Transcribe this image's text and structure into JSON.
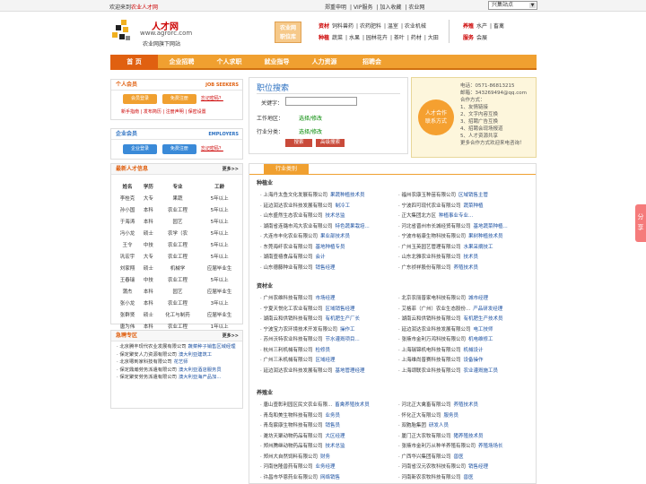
{
  "topbar": {
    "welcome_pre": "欢迎来到",
    "welcome_site": "农业人才网",
    "links": [
      "郑重申明",
      "VIP服务",
      "加入收藏",
      "农业网"
    ],
    "site_select": "兴集站点"
  },
  "logo": {
    "name": "人才网",
    "url": "www.agrorc.com",
    "slogan": "农业网旗下网站"
  },
  "category_box": "农业网\n职位库",
  "categories": {
    "row1": {
      "key": "资材",
      "items": [
        "饲料兽药",
        "农药肥料",
        "温室",
        "农业机械"
      ]
    },
    "row2": {
      "key": "种植",
      "items": [
        "蔬菜",
        "水果",
        "园林花卉",
        "茶叶",
        "药材",
        "大田"
      ]
    },
    "row3": {
      "key": "养殖",
      "items": [
        "水产",
        "畜禽"
      ]
    },
    "row4": {
      "key": "服务",
      "items": [
        "会展"
      ]
    }
  },
  "nav": [
    "首 页",
    "企业招聘",
    "个人求职",
    "就业指导",
    "人力资源",
    "招聘会"
  ],
  "personal": {
    "title": "个人会员",
    "en": "JOB SEEKERS",
    "login": "会员登录",
    "register": "免费注册",
    "forgot": "忘记密码？",
    "links": [
      "新手指南",
      "发布简历",
      "注册声明",
      "保密设置"
    ]
  },
  "company": {
    "title": "企业会员",
    "en": "EMPLOYERS",
    "login": "企业登录",
    "register": "免费注册",
    "forgot": "忘记密码？"
  },
  "newtalent": {
    "title": "最新人才信息",
    "more": "更多>>",
    "headers": [
      "姓名",
      "学历",
      "专业",
      "工龄"
    ],
    "rows": [
      [
        "李桂克",
        "大专",
        "果蔬",
        "5年以上"
      ],
      [
        "孙小国",
        "本科",
        "农业工程",
        "5年以上"
      ],
      [
        "于海涛",
        "本科",
        "园艺",
        "5年以上"
      ],
      [
        "冯小龙",
        "硕士",
        "农学（农",
        "5年以上"
      ],
      [
        "王令",
        "中技",
        "农业工程",
        "5年以上"
      ],
      [
        "巩宏宇",
        "大专",
        "农业工程",
        "5年以上"
      ],
      [
        "刘家翔",
        "硕士",
        "机械学",
        "应届毕业生"
      ],
      [
        "王春瑞",
        "中技",
        "农业工程",
        "5年以上"
      ],
      [
        "蒲杰",
        "本科",
        "园艺",
        "应届毕业生"
      ],
      [
        "张小龙",
        "本科",
        "农业工程",
        "3年以上"
      ],
      [
        "张群贤",
        "硕士",
        "化工与制药",
        "应届毕业生"
      ],
      [
        "唐为伟",
        "本科",
        "农业工程",
        "1年以上"
      ]
    ]
  },
  "urgent": {
    "title": "急聘专区",
    "more": "更多>>",
    "items": [
      [
        "北京腾丰现代农业发展有限公司",
        "蔬菜种子销售区域经理"
      ],
      [
        "保定聚安人力资源有限公司",
        "澳大利亚建筑工"
      ],
      [
        "北京嗯到家科技有限公司",
        "花艺师"
      ],
      [
        "保定鼎瀚劳务派遣有限公司",
        "澳大利亚酒店服务员"
      ],
      [
        "保定聚安劳务派遣有限公司",
        "澳大利亚海产品加..."
      ]
    ]
  },
  "search": {
    "title": "职位搜索",
    "keyword_label": "关键字：",
    "area_label": "工作地区：",
    "area_value": "选择/修改",
    "cat_label": "行业分类：",
    "cat_value": "选择/修改",
    "search_btn": "搜索",
    "adv_btn": "高级搜索"
  },
  "contact": {
    "badge": "人才合作\n联系方式",
    "phone": "电话：0571-86813215",
    "qq": "邮箱：343269494@qq.com",
    "coop": "合作方式：",
    "items": [
      "1、友情链接",
      "2、文字内容互换",
      "3、招聘广告互换",
      "4、招聘会现场报道",
      "5、人才资源共享"
    ],
    "more": "更多合作方式欢迎来电咨询！"
  },
  "industry": {
    "tab": "行业类别",
    "sections": [
      {
        "title": "种植业",
        "rows": [
          [
            "上海丹太鱼文化发展有限公司",
            "果蔬种植技术员",
            "福州农康玉种苗有限公司",
            "区域销售主管"
          ],
          [
            "延边润达农业科技发展有限公司",
            "制冷工",
            "宁波四可现代农业有限公司",
            "蔬菜种植"
          ],
          [
            "山东盛然生态农业有限公司",
            "技术总监",
            "正大集团北方区",
            "种植事业专业..."
          ],
          [
            "湖南省连璐市鸿大农业有限公司",
            "特色蔬果栽培...",
            "河北省晋州市长城经贸有限公司",
            "基地蔬菜种植..."
          ],
          [
            "大连市丰化农业有限公司",
            "果业部技术员",
            "宁波市裕康生物科技有限公司",
            "果树种植技术员"
          ],
          [
            "东莞海纤农业有限公司",
            "基地种植专员",
            "广州玉英园艺管理有限公司",
            "水果采摘技工"
          ],
          [
            "湖南壹禧食品有限公司",
            "会计",
            "山东北雅农业科技有限公司",
            "技术员"
          ],
          [
            "山东德藤种业有限公司",
            "销售经理",
            "广东祯祥股份有限公司",
            "养殖技术员"
          ]
        ]
      },
      {
        "title": "资材业",
        "rows": [
          [
            "广州农维科技有限公司",
            "市场经理",
            "北京农丽普家电科技有限公司",
            "城市经理"
          ],
          [
            "宁夏天悦化工农业有限公司",
            "区域销售经理",
            "艾格菲（广州）农业生态股份...",
            "产品研发经理"
          ],
          [
            "湖南云和供销科技有限公司",
            "有机肥生产厂长",
            "湖南云和供销科技有限公司",
            "有机肥生产技术员"
          ],
          [
            "宁波宝力农环境技术开发有限公司",
            "操作工",
            "延边润达农业科技发展有限公司",
            "电工技师"
          ],
          [
            "苏州沃特农业科技有限公司",
            "节水灌溉项目...",
            "张掖市金利万鸿科技有限公司",
            "机电维修工"
          ],
          [
            "杭州三利机械有限公司",
            "检修员",
            "上海瑞锦机电科技有限公司",
            "机械设计"
          ],
          [
            "广州三禾机械有限公司",
            "区域经理",
            "上海维尚普赛科技有限公司",
            "设备操作"
          ],
          [
            "延边润达农业科技发展有限公司",
            "基地管理经理",
            "上海颂联农业科技有限公司",
            "农业灌溉施工员"
          ]
        ]
      },
      {
        "title": "养殖业",
        "rows": [
          [
            "唐山壹彰利园区民文农业有限...",
            "畜禽养殖技术员",
            "河北正大禽畜有限公司",
            "养殖技术员"
          ],
          [
            "青岛和美生物科技有限公司",
            "业务员",
            "怀化正大有限公司",
            "服务员"
          ],
          [
            "青岛宸康生物科技有限公司",
            "销售员",
            "双胞胎集团",
            "研发人员"
          ],
          [
            "潍坊天聚动物药品有限公司",
            "大区经理",
            "厦门正大农牧有限公司",
            "猪养殖技术员"
          ],
          [
            "郑州腾继动物药品有限公司",
            "技术总监",
            "张掖市金利万从种羊养殖有限公司",
            "养殖场场长"
          ],
          [
            "郑州大自然饲料有限公司",
            "财务",
            "广西华兴集团有限公司",
            "兽医"
          ],
          [
            "河南信隆兽药有限公司",
            "业务经理",
            "河南省汉元农牧科技有限公司",
            "销售经理"
          ],
          [
            "许昌市华恩药业有限公司",
            "网络销售",
            "河南新农农牧科技有限公司",
            "兽医"
          ]
        ]
      }
    ]
  },
  "share": "分享"
}
